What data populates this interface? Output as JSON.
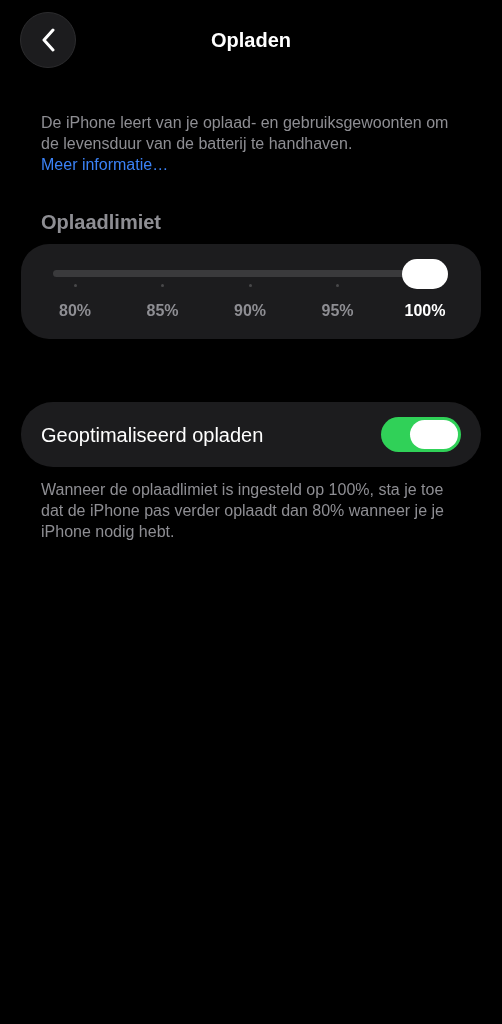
{
  "nav": {
    "title": "Opladen"
  },
  "description": {
    "text": "De iPhone leert van je oplaad- en gebruiksgewoonten om de levensduur van de batterij te handhaven.",
    "link": "Meer informatie…"
  },
  "charge_limit": {
    "header": "Oplaadlimiet",
    "level": 1,
    "ticks": [
      {
        "label": "80%",
        "selected": false
      },
      {
        "label": "85%",
        "selected": false
      },
      {
        "label": "90%",
        "selected": false
      },
      {
        "label": "95%",
        "selected": false
      },
      {
        "label": "100%",
        "selected": true
      }
    ]
  },
  "optimized_charging": {
    "label": "Geoptimaliseerd opladen",
    "on": true,
    "footer": "Wanneer de oplaadlimiet is ingesteld op 100%, sta je toe dat de iPhone pas verder oplaadt dan 80% wanneer je je iPhone nodig hebt."
  }
}
